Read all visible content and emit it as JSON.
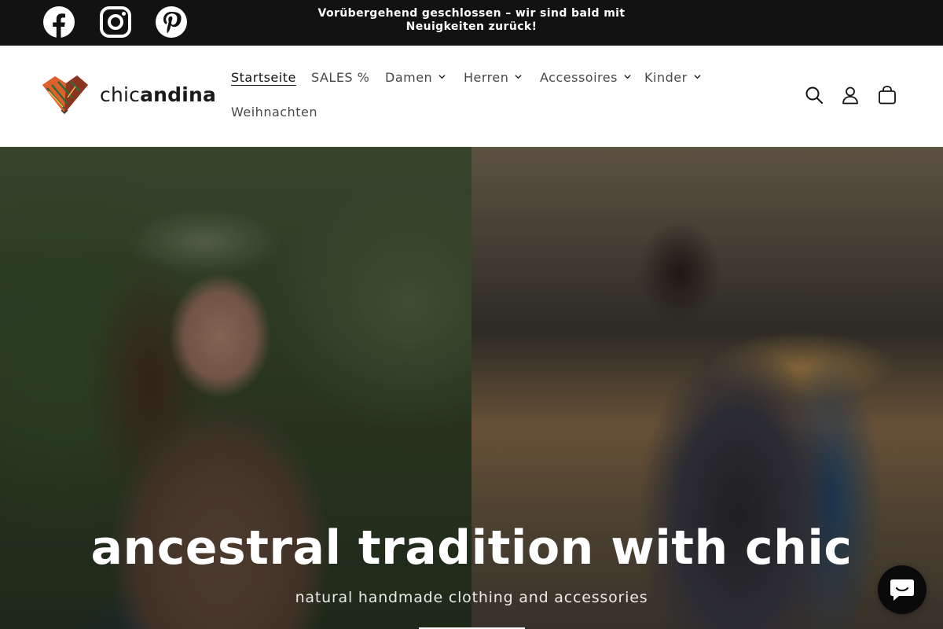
{
  "announcement": {
    "text": "Vorübergehend geschlossen – wir sind bald mit Neuigkeiten zurück!"
  },
  "social": [
    {
      "name": "facebook-icon"
    },
    {
      "name": "instagram-icon"
    },
    {
      "name": "pinterest-icon"
    }
  ],
  "brand": {
    "logo_prefix": "chic",
    "logo_bold": "andina"
  },
  "nav": {
    "items": [
      {
        "label": "Startseite",
        "active": true,
        "dropdown": false
      },
      {
        "label": "SALES %",
        "active": false,
        "dropdown": false
      },
      {
        "label": "Damen",
        "active": false,
        "dropdown": true
      },
      {
        "label": "Herren",
        "active": false,
        "dropdown": true
      },
      {
        "label": "Accessoires",
        "active": false,
        "dropdown": true
      },
      {
        "label": "Kinder",
        "active": false,
        "dropdown": true
      },
      {
        "label": "Weihnachten",
        "active": false,
        "dropdown": false
      }
    ]
  },
  "header_icons": [
    "search-icon",
    "account-icon",
    "cart-icon"
  ],
  "hero": {
    "title": "ancestral tradition with chic",
    "subtitle": "natural handmade clothing and accessories"
  },
  "colors": {
    "topbar": "#121212",
    "text": "#121212",
    "chat": "#0a0a0a"
  }
}
